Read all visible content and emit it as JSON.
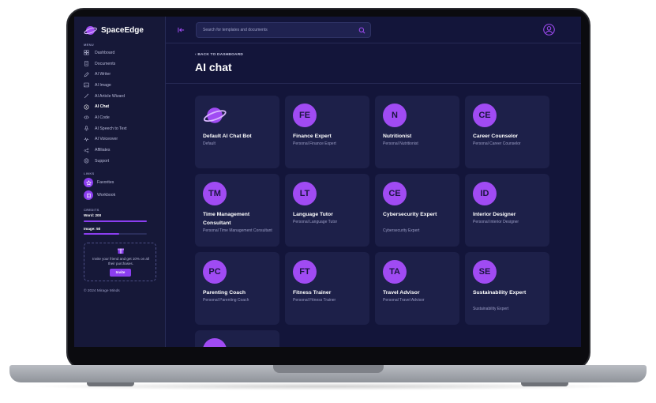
{
  "brand": {
    "name": "SpaceEdge"
  },
  "sidebar": {
    "menu_label": "MENU",
    "items": [
      {
        "label": "Dashboard",
        "icon": "grid-icon"
      },
      {
        "label": "Documents",
        "icon": "document-icon"
      },
      {
        "label": "AI Writer",
        "icon": "pen-icon"
      },
      {
        "label": "AI Image",
        "icon": "image-icon"
      },
      {
        "label": "AI Article Wizard",
        "icon": "wand-icon"
      },
      {
        "label": "AI Chat",
        "icon": "chat-icon",
        "active": true
      },
      {
        "label": "AI Code",
        "icon": "code-icon"
      },
      {
        "label": "AI Speech to Text",
        "icon": "mic-icon"
      },
      {
        "label": "AI Voiceover",
        "icon": "waveform-icon"
      },
      {
        "label": "Affiliates",
        "icon": "share-icon"
      },
      {
        "label": "Support",
        "icon": "support-icon"
      }
    ],
    "links_label": "LINKS",
    "links": [
      {
        "label": "Favorites",
        "icon": "star-icon"
      },
      {
        "label": "Workbook",
        "icon": "book-icon"
      }
    ],
    "credits_label": "CREDITS",
    "credits": [
      {
        "label": "Word: 200",
        "fill": 1.0
      },
      {
        "label": "Image: 50",
        "fill": 0.56
      }
    ],
    "invite": {
      "text": "Invite your friend and get 10% on all their purchases.",
      "button": "Invite"
    },
    "copyright": "© 2024 Mirage Minds"
  },
  "topbar": {
    "search_placeholder": "Search for templates and documents"
  },
  "main": {
    "back_label": "BACK TO DASHBOARD",
    "title": "AI chat",
    "cards": [
      {
        "badge": "",
        "title": "Default AI Chat Bot",
        "subtitle": "Default",
        "logo": true
      },
      {
        "badge": "FE",
        "title": "Finance Expert",
        "subtitle": "Personal Finance Expert"
      },
      {
        "badge": "N",
        "title": "Nutritionist",
        "subtitle": "Personal Nutritionist"
      },
      {
        "badge": "CE",
        "title": "Career Counselor",
        "subtitle": "Personal Career Counselor"
      },
      {
        "badge": "TM",
        "title": "Time Management Consultant",
        "subtitle": "Personal Time Management Consultant"
      },
      {
        "badge": "LT",
        "title": "Language Tutor",
        "subtitle": "Personal Language Tutor"
      },
      {
        "badge": "CE",
        "title": "Cybersecurity Expert",
        "subtitle": "Cybersecurity Expert"
      },
      {
        "badge": "ID",
        "title": "Interior Designer",
        "subtitle": "Personal Interior Designer"
      },
      {
        "badge": "PC",
        "title": "Parenting Coach",
        "subtitle": "Personal Parenting Coach"
      },
      {
        "badge": "FT",
        "title": "Fitness Trainer",
        "subtitle": "Personal Fitness Trainer"
      },
      {
        "badge": "TA",
        "title": "Travel Advisor",
        "subtitle": "Personal Travel Advisor"
      },
      {
        "badge": "SE",
        "title": "Sustainability Expert",
        "subtitle": "Sustainability Expert"
      },
      {
        "badge": "",
        "title": "",
        "subtitle": ""
      }
    ]
  },
  "colors": {
    "accent": "#8b3ef0",
    "background": "#13153a",
    "card": "#1d2049"
  }
}
